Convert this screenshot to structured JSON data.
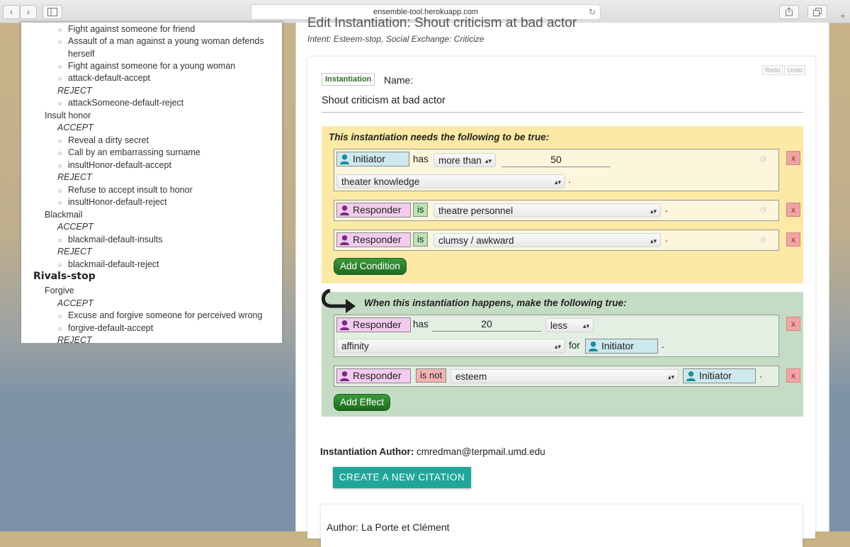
{
  "browser": {
    "url": "ensemble-tool.herokuapp.com",
    "back_glyph": "‹",
    "forward_glyph": "›",
    "plus_glyph": "+"
  },
  "sidebar": {
    "rows": [
      {
        "type": "bullet",
        "text": "Fight against someone for friend"
      },
      {
        "type": "bullet",
        "text": "Assault of a man against a young woman defends"
      },
      {
        "type": "cont",
        "text": "herself"
      },
      {
        "type": "bullet",
        "text": "Fight against someone for a young woman"
      },
      {
        "type": "bullet",
        "text": "attack-default-accept"
      },
      {
        "type": "hdr",
        "text": "REJECT"
      },
      {
        "type": "bullet",
        "text": "attackSomeone-default-reject"
      },
      {
        "type": "cat",
        "text": "Insult honor"
      },
      {
        "type": "hdr",
        "text": "ACCEPT"
      },
      {
        "type": "bullet",
        "text": "Reveal a dirty secret"
      },
      {
        "type": "bullet",
        "text": "Call by an embarrassing surname"
      },
      {
        "type": "bullet",
        "text": "insultHonor-default-accept"
      },
      {
        "type": "hdr",
        "text": "REJECT"
      },
      {
        "type": "bullet",
        "text": "Refuse to accept insult to honor"
      },
      {
        "type": "bullet",
        "text": "insultHonor-default-reject"
      },
      {
        "type": "cat",
        "text": "Blackmail"
      },
      {
        "type": "hdr",
        "text": "ACCEPT"
      },
      {
        "type": "bullet",
        "text": "blackmail-default-insults"
      },
      {
        "type": "hdr",
        "text": "REJECT"
      },
      {
        "type": "bullet",
        "text": "blackmail-default-reject"
      },
      {
        "type": "group",
        "text": "Rivals-stop"
      },
      {
        "type": "cat",
        "text": "Forgive"
      },
      {
        "type": "hdr",
        "text": "ACCEPT"
      },
      {
        "type": "bullet",
        "text": "Excuse and forgive someone for perceived wrong"
      },
      {
        "type": "bullet",
        "text": "forgive-default-accept"
      },
      {
        "type": "hdr",
        "text": "REJECT"
      }
    ]
  },
  "main": {
    "title_partial": "Edit Instantiation: Shout criticism at bad actor",
    "intent": "Intent: Esteem-stop, Social Exchange: Criticize",
    "badge": "Instantiation",
    "name_label": "Name:",
    "name_value": "Shout criticism at bad actor",
    "redo": "Redo",
    "undo": "Undo",
    "conditions": {
      "title": "This instantiation needs the following to be true:",
      "add_button": "Add Condition",
      "c1": {
        "role": "Initiator",
        "verb": "has",
        "op": "more than",
        "value": "50",
        "predicate": "theater knowledge",
        "end": "."
      },
      "c2": {
        "role": "Responder",
        "is": "is",
        "predicate": "theatre personnel",
        "end": "."
      },
      "c3": {
        "role": "Responder",
        "is": "is",
        "predicate": "clumsy / awkward",
        "end": "."
      }
    },
    "effects": {
      "title": "When this instantiation happens, make the following true:",
      "add_button": "Add Effect",
      "e1": {
        "role": "Responder",
        "verb": "has",
        "value": "20",
        "op": "less",
        "predicate": "affinity",
        "for": "for",
        "target": "Initiator",
        "end": "."
      },
      "e2": {
        "role": "Responder",
        "is": "is not",
        "predicate": "esteem",
        "target": "Initiator",
        "end": "."
      }
    },
    "author_label": "Instantiation Author:",
    "author_value": "cmredman@terpmail.umd.edu",
    "citation_button": "CREATE A NEW CITATION",
    "citation_author": "Author: La Porte et Clément",
    "delete_glyph": "x",
    "clock_glyph": "◷",
    "caret_glyph": "▴▾"
  },
  "colors": {
    "initiator_bg": "#cde9ee",
    "responder_bg": "#f2cbee",
    "conditions_bg": "#fce9a5",
    "effects_bg": "#c4dcc4",
    "citation_button": "#21a69a"
  }
}
